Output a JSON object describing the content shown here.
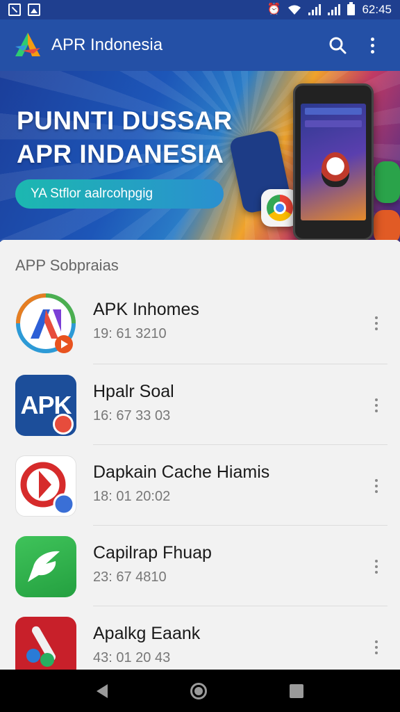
{
  "status_bar": {
    "time": "62:45",
    "left_icons": [
      "notification-n-icon",
      "image-icon"
    ],
    "right_icons": [
      "alarm-icon",
      "wifi-icon",
      "signal-icon",
      "signal-icon",
      "battery-icon"
    ]
  },
  "app_bar": {
    "title": "APR Indonesia",
    "icons": [
      "app-logo-icon",
      "search-icon",
      "more-vert-icon"
    ],
    "color": "#2450a6"
  },
  "banner": {
    "headline_line1": "PUNNTI DUSSAR",
    "headline_line2": "APR INDANESIA",
    "pill_text": "YA Stflor aalrcohpgig"
  },
  "list": {
    "section_title": "APP Sobpraias",
    "items": [
      {
        "title": "APK Inhomes",
        "subtitle": "19: 61 3210",
        "icon": "apk-inhomes-icon",
        "more_icon": "more-vert-icon"
      },
      {
        "title": "Hpalr Soal",
        "subtitle": "16: 67 33 03",
        "icon": "apk-blue-icon",
        "icon_text": "APK",
        "more_icon": "more-vert-icon"
      },
      {
        "title": "Dapkain Cache Hiamis",
        "subtitle": "18: 01 20:02",
        "icon": "cache-cleaner-icon",
        "more_icon": "more-vert-icon"
      },
      {
        "title": "Capilrap Fhuap",
        "subtitle": "23: 67 4810",
        "icon": "green-chat-icon",
        "more_icon": "more-vert-icon"
      },
      {
        "title": "Apalkg Eaank",
        "subtitle": "43: 01 20 43",
        "icon": "red-tools-icon",
        "more_icon": "more-vert-icon"
      }
    ]
  },
  "nav_bar": {
    "icons": [
      "back-icon",
      "home-icon",
      "recents-icon"
    ]
  }
}
